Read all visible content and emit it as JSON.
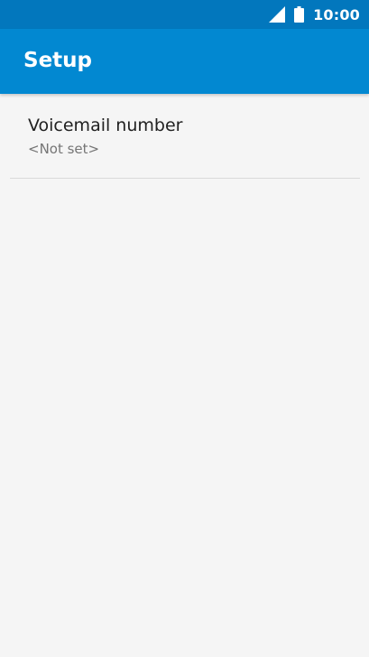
{
  "status_bar": {
    "time": "10:00",
    "icons": [
      "signal-icon",
      "battery-icon"
    ]
  },
  "app_bar": {
    "title": "Setup"
  },
  "preferences": [
    {
      "title": "Voicemail number",
      "summary": "<Not set>"
    }
  ],
  "colors": {
    "status_bar": "#0277bd",
    "app_bar": "#0288d1",
    "background": "#f5f5f5",
    "title_text": "#212121",
    "summary_text": "#757575"
  }
}
